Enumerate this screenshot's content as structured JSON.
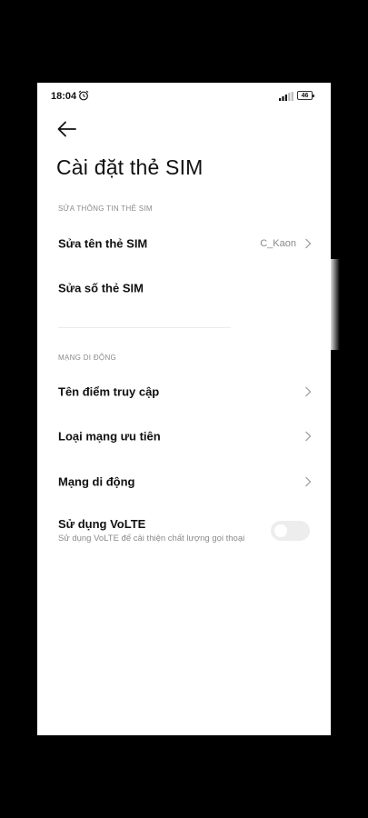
{
  "status_bar": {
    "time": "18:04",
    "battery": "46",
    "alarm_icon": "alarm-clock-icon",
    "signal_icon": "signal-bars-icon"
  },
  "header": {
    "back_icon": "arrow-left-icon",
    "title": "Cài đặt thẻ SIM"
  },
  "sections": {
    "sim_info": {
      "header": "SỬA THÔNG TIN THẺ SIM",
      "edit_name": {
        "label": "Sửa tên thẻ SIM",
        "value": "C_Kaon"
      },
      "edit_number": {
        "label": "Sửa số thẻ SIM"
      }
    },
    "mobile_network": {
      "header": "MẠNG DI ĐỘNG",
      "apn": {
        "label": "Tên điểm truy cập"
      },
      "preferred_network": {
        "label": "Loại mạng ưu tiên"
      },
      "mobile_network": {
        "label": "Mạng di động"
      },
      "volte": {
        "label": "Sử dụng VoLTE",
        "description": "Sử dụng VoLTE để cải thiện chất lượng gọi thoại",
        "enabled": false
      }
    }
  },
  "colors": {
    "background": "#000000",
    "panel": "#ffffff",
    "text_primary": "#111111",
    "text_secondary": "#8a8a8a",
    "toggle_off": "#ededed"
  }
}
